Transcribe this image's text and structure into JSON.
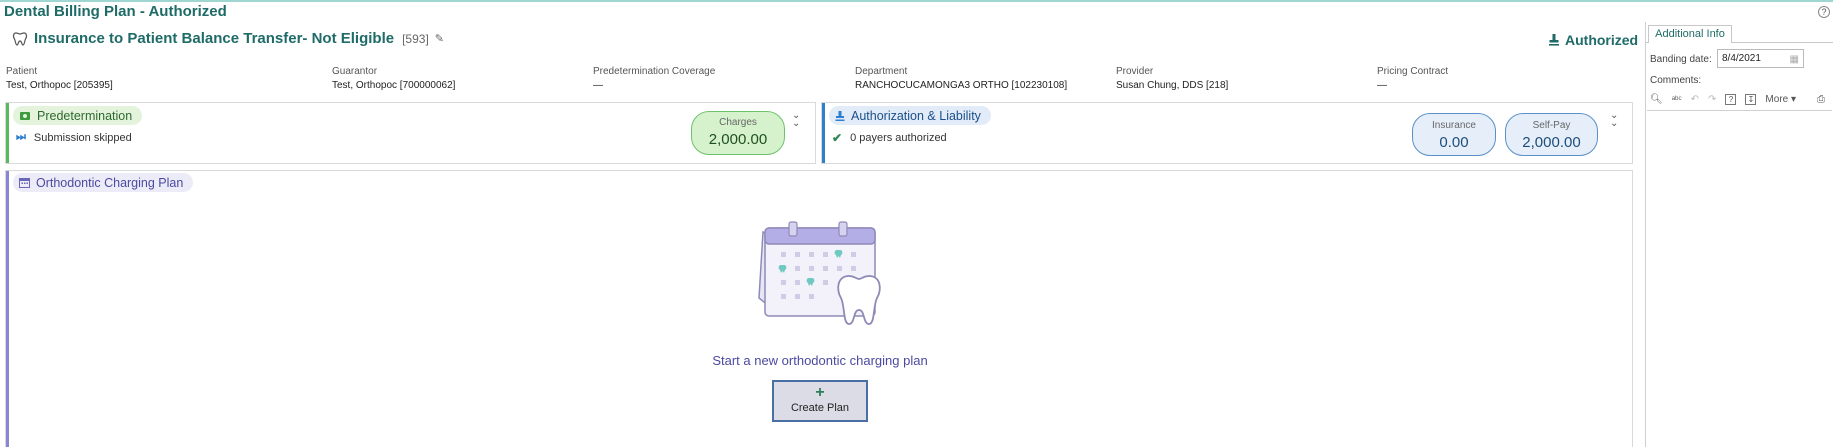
{
  "app": {
    "title": "Dental Billing Plan - Authorized"
  },
  "plan": {
    "name": "Insurance to Patient Balance Transfer- Not Eligible",
    "id": "[593]",
    "status": "Authorized"
  },
  "info": [
    {
      "label": "Patient",
      "value": "Test, Orthopoc [205395]"
    },
    {
      "label": "Guarantor",
      "value": "Test, Orthopoc [700000062]"
    },
    {
      "label": "Predetermination Coverage",
      "value": "—"
    },
    {
      "label": "Department",
      "value": "RANCHOCUCAMONGA3 ORTHO [102230108]"
    },
    {
      "label": "Provider",
      "value": "Susan Chung, DDS [218]"
    },
    {
      "label": "Pricing Contract",
      "value": "—"
    }
  ],
  "predetermination": {
    "title": "Predetermination",
    "status": "Submission skipped",
    "charges_label": "Charges",
    "charges_value": "2,000.00"
  },
  "authorization": {
    "title": "Authorization & Liability",
    "status": "0 payers authorized",
    "insurance_label": "Insurance",
    "insurance_value": "0.00",
    "selfpay_label": "Self-Pay",
    "selfpay_value": "2,000.00"
  },
  "ortho": {
    "title": "Orthodontic Charging Plan",
    "empty_message": "Start a new orthodontic charging plan",
    "create_label": "Create Plan"
  },
  "side": {
    "tab": "Additional Info",
    "banding_label": "Banding date:",
    "banding_value": "8/4/2021",
    "comments_label": "Comments:",
    "more_label": "More"
  },
  "colors": {
    "teal": "#1e6b67",
    "green_accent": "#5cb85c",
    "blue_accent": "#2f7fcf",
    "purple_accent": "#8a86d6"
  }
}
